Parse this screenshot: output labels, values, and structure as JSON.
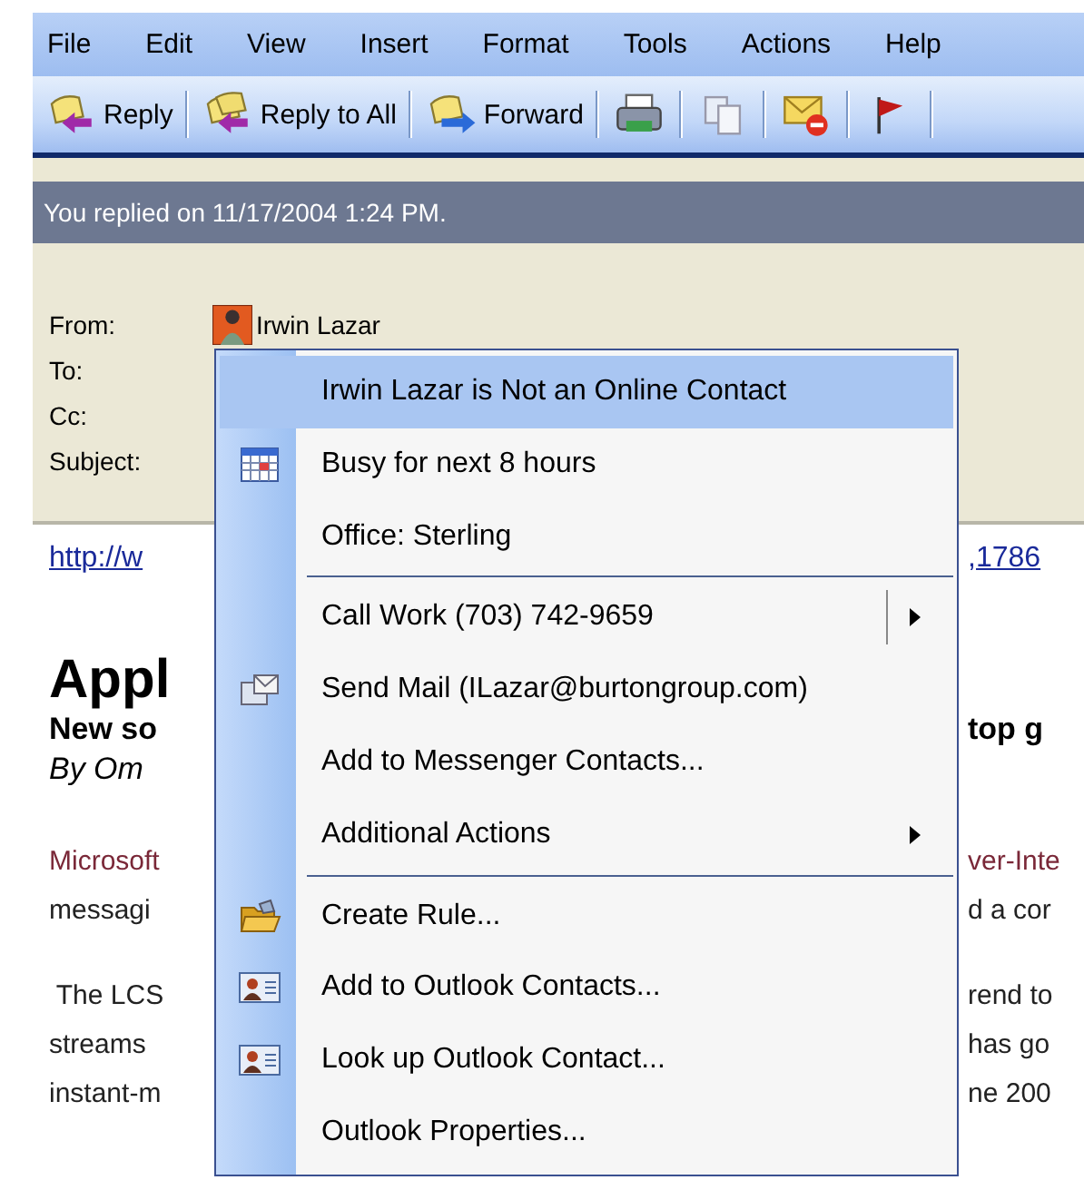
{
  "menu_bar": [
    "File",
    "Edit",
    "View",
    "Insert",
    "Format",
    "Tools",
    "Actions",
    "Help"
  ],
  "toolbar": [
    {
      "kind": "reply",
      "label": "Reply"
    },
    {
      "kind": "reply-all",
      "label": "Reply to All"
    },
    {
      "kind": "forward",
      "label": "Forward"
    },
    {
      "kind": "print"
    },
    {
      "kind": "copy"
    },
    {
      "kind": "mail-delete"
    },
    {
      "kind": "flag"
    }
  ],
  "info_bar": "You replied on 11/17/2004 1:24 PM.",
  "header": {
    "from_label": "From:",
    "from": "Irwin Lazar",
    "to_label": "To:",
    "cc_label": "Cc:",
    "subject_label": "Subject:"
  },
  "article": {
    "link": {
      "left": "http://w",
      "right": ",1786"
    },
    "title": "Appl",
    "subtitle": {
      "left": "New so",
      "right": "top g"
    },
    "byline": "By Om",
    "paragraphs": [
      {
        "lines": [
          {
            "left": "Microsoft",
            "right": "ver-Inte",
            "color": "#7a2838"
          },
          {
            "left": "messagi",
            "right": "d a cor"
          }
        ]
      },
      {
        "lines": [
          {
            "left": " The LCS",
            "right": "rend to"
          },
          {
            "left": "streams",
            "right": "has go"
          },
          {
            "left": "instant-m",
            "right": "ne 200"
          }
        ]
      }
    ]
  },
  "context_menu": [
    {
      "kind": "plain",
      "label": "Irwin Lazar is Not an Online Contact",
      "selected": true
    },
    {
      "kind": "calendar",
      "label": "Busy for next 8 hours",
      "selected": false
    },
    {
      "kind": "plain",
      "label": "Office: Sterling",
      "selected": false
    },
    {
      "kind": "split-submenu",
      "label": "Call Work (703) 742-9659",
      "separator_before": true,
      "selected": false
    },
    {
      "kind": "mail",
      "label": "Send Mail (ILazar@burtongroup.com)",
      "selected": false
    },
    {
      "kind": "plain",
      "label": "Add to Messenger Contacts...",
      "selected": false
    },
    {
      "kind": "submenu",
      "label": "Additional Actions",
      "selected": false
    },
    {
      "kind": "folder",
      "label": "Create Rule...",
      "separator_before": true,
      "selected": false
    },
    {
      "kind": "card",
      "label": "Add to Outlook Contacts...",
      "selected": false
    },
    {
      "kind": "card",
      "label": "Look up Outlook Contact...",
      "selected": false
    },
    {
      "kind": "plain",
      "label": "Outlook Properties...",
      "selected": false
    }
  ]
}
